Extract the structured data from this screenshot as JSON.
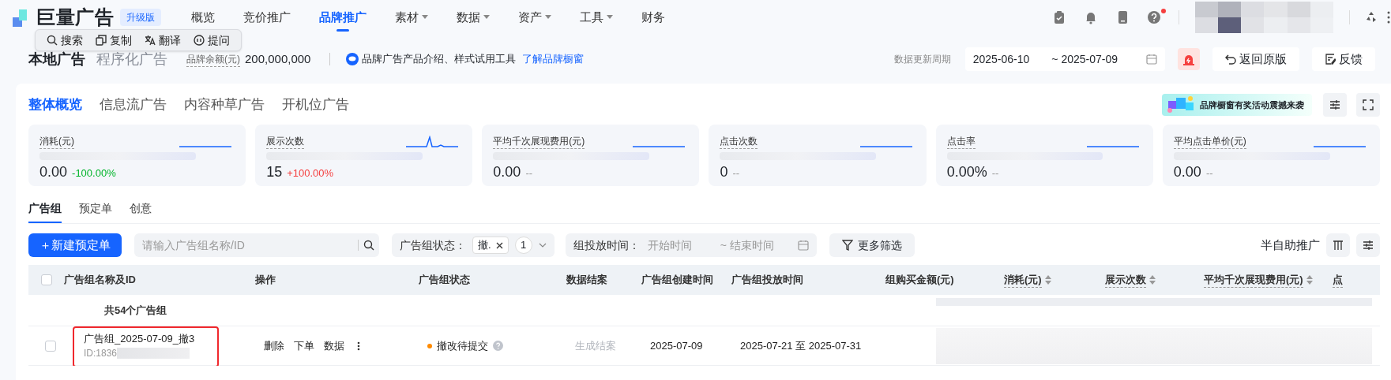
{
  "app": {
    "logo": "巨量广告",
    "edition": "升级版"
  },
  "nav": [
    {
      "label": "概览",
      "selected": false,
      "has_menu": false
    },
    {
      "label": "竞价推广",
      "selected": false,
      "has_menu": false
    },
    {
      "label": "品牌推广",
      "selected": true,
      "has_menu": false
    },
    {
      "label": "素材",
      "selected": false,
      "has_menu": true
    },
    {
      "label": "数据",
      "selected": false,
      "has_menu": true
    },
    {
      "label": "资产",
      "selected": false,
      "has_menu": true
    },
    {
      "label": "工具",
      "selected": false,
      "has_menu": true
    },
    {
      "label": "财务",
      "selected": false,
      "has_menu": false
    }
  ],
  "header_icons": [
    {
      "kind": "clipboard",
      "badge": false
    },
    {
      "kind": "bell",
      "badge": false
    },
    {
      "kind": "tablet",
      "badge": false
    },
    {
      "kind": "help",
      "badge": true
    }
  ],
  "selection_popup": [
    "搜索",
    "复制",
    "翻译",
    "提问"
  ],
  "account_row": {
    "modes": [
      {
        "label": "本地广告",
        "selected": true
      },
      {
        "label": "程序化广告",
        "selected": false
      }
    ],
    "balance_label": "品牌余额(元)",
    "balance": "200,000,000",
    "info": "品牌广告产品介绍、样式试用工具",
    "info_link": "了解品牌橱窗",
    "period_label": "数据更新周期",
    "date_from": "2025-06-10",
    "date_to": "~ 2025-07-09",
    "back_button": "返回原版",
    "feedback_button": "反馈"
  },
  "overview_tabs": [
    {
      "label": "整体概览",
      "selected": true
    },
    {
      "label": "信息流广告",
      "selected": false
    },
    {
      "label": "内容种草广告",
      "selected": false
    },
    {
      "label": "开机位广告",
      "selected": false
    }
  ],
  "promo_banner": "品牌橱窗有奖活动震撼来袭",
  "metrics": [
    {
      "label": "消耗(元)",
      "value": "0.00",
      "delta": "-100.00%",
      "color": "#00b42a",
      "kind": "flat"
    },
    {
      "label": "展示次数",
      "value": "15",
      "delta": "+100.00%",
      "color": "#f53f3f",
      "kind": "spike"
    },
    {
      "label": "平均千次展现费用(元)",
      "value": "0.00",
      "delta": "--",
      "color": "#999999",
      "kind": "flat"
    },
    {
      "label": "点击次数",
      "value": "0",
      "delta": "--",
      "color": "#999999",
      "kind": "flat"
    },
    {
      "label": "点击率",
      "value": "0.00%",
      "delta": "--",
      "color": "#999999",
      "kind": "flat"
    },
    {
      "label": "平均点击单价(元)",
      "value": "0.00",
      "delta": "--",
      "color": "#999999",
      "kind": "flat"
    }
  ],
  "list_tabs": [
    {
      "label": "广告组",
      "selected": true
    },
    {
      "label": "预定单",
      "selected": false
    },
    {
      "label": "创意",
      "selected": false
    }
  ],
  "toolbar": {
    "new_button": "＋新建预定单",
    "search_placeholder": "请输入广告组名称/ID",
    "status_label": "广告组状态：",
    "status_chip": "撤.",
    "status_count": "1",
    "time_label": "组投放时间：",
    "start_placeholder": "开始时间",
    "end_placeholder": "~ 结束时间",
    "more_filters": "更多筛选",
    "mode_label": "半自助推广"
  },
  "table": {
    "columns": [
      {
        "label": "广告组名称及ID",
        "sortable": false,
        "hint": false
      },
      {
        "label": "操作",
        "sortable": false,
        "hint": false
      },
      {
        "label": "广告组状态",
        "sortable": false,
        "hint": false
      },
      {
        "label": "数据结案",
        "sortable": false,
        "hint": false
      },
      {
        "label": "广告组创建时间",
        "sortable": false,
        "hint": false
      },
      {
        "label": "广告组投放时间",
        "sortable": false,
        "hint": false
      },
      {
        "label": "组购买金额(元)",
        "sortable": false,
        "hint": false
      },
      {
        "label": "消耗(元)",
        "sortable": true,
        "hint": true
      },
      {
        "label": "展示次数",
        "sortable": true,
        "hint": true
      },
      {
        "label": "平均千次展现费用(元)",
        "sortable": true,
        "hint": true
      },
      {
        "label": "点",
        "sortable": false,
        "hint": true
      }
    ],
    "header_checked": false,
    "summary": "共54个广告组",
    "rows": [
      {
        "checked": false,
        "highlighted": true,
        "name": "广告组_2025-07-09_撤3",
        "id": "ID:1836",
        "actions": [
          "删除",
          "下单",
          "数据"
        ],
        "status": "撤改待提交",
        "color": "#ff8a00",
        "closing": "生成结案",
        "created": "2025-07-09",
        "period": "2025-07-21 至 2025-07-31"
      }
    ]
  }
}
